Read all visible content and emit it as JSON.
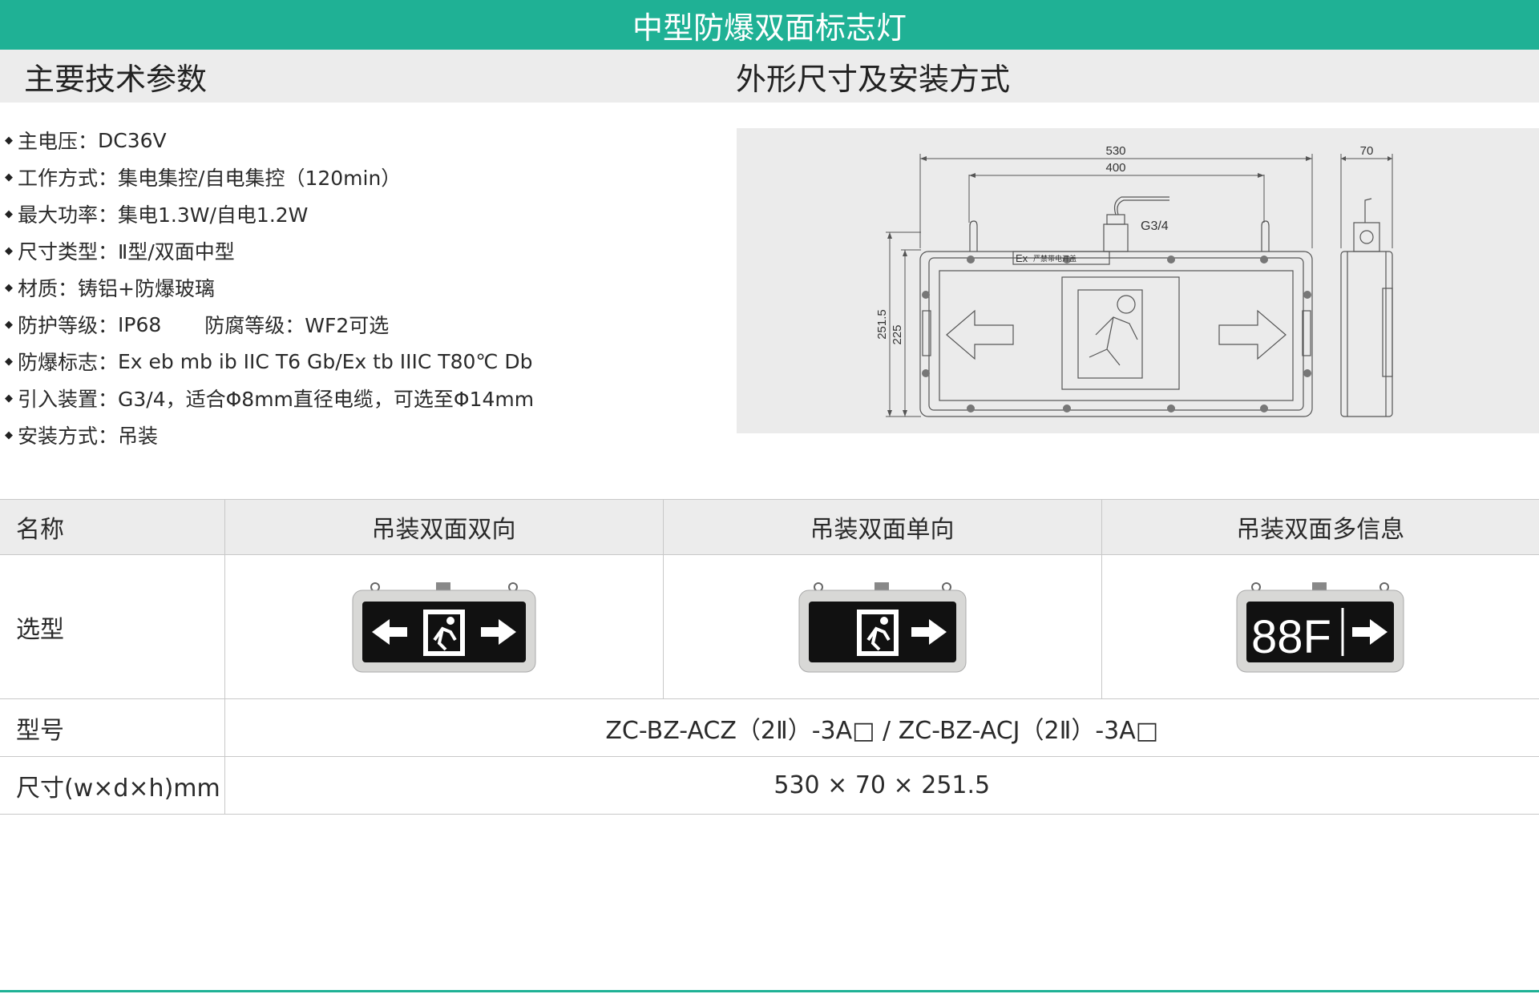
{
  "header": {
    "title": "中型防爆双面标志灯"
  },
  "sections": {
    "left_title": "主要技术参数",
    "right_title": "外形尺寸及安装方式"
  },
  "specs": [
    {
      "label": "主电压：",
      "value": "DC36V"
    },
    {
      "label": "工作方式：",
      "value": "集电集控/自电集控（120min）"
    },
    {
      "label": "最大功率：",
      "value": "集电1.3W/自电1.2W"
    },
    {
      "label": "尺寸类型：",
      "value": "Ⅱ型/双面中型"
    },
    {
      "label": "材质：",
      "value": "铸铝+防爆玻璃"
    },
    {
      "label": "防护等级：",
      "value": "IP68",
      "label2": "防腐等级：",
      "value2": "WF2可选"
    },
    {
      "label": "防爆标志：",
      "value": "Ex eb mb ib IIC T6 Gb/Ex tb IIIC T80℃ Db"
    },
    {
      "label": "引入装置：",
      "value": "G3/4，适合Φ8mm直径电缆，可选至Φ14mm"
    },
    {
      "label": "安装方式：",
      "value": "吊装"
    }
  ],
  "drawing": {
    "dim_width_total": "530",
    "dim_width_mount": "400",
    "dim_depth": "70",
    "dim_height_total": "251.5",
    "dim_height_body": "225",
    "thread_label": "G3/4",
    "ex_mark": "Ex",
    "warning_label": "严禁带电开盖"
  },
  "table": {
    "head": {
      "name": "名称",
      "cols": [
        "吊装双面双向",
        "吊装双面单向",
        "吊装双面多信息"
      ]
    },
    "row_image": {
      "label": "选型",
      "sign_text": "88F"
    },
    "row_model": {
      "label": "型号",
      "value": "ZC-BZ-ACZ（2Ⅱ）-3A□ / ZC-BZ-ACJ（2Ⅱ）-3A□"
    },
    "row_size": {
      "label": "尺寸(w×d×h)mm",
      "value": "530 × 70 × 251.5"
    }
  },
  "colors": {
    "accent": "#1fb195",
    "band": "#ececec",
    "drawing_bg": "#ebebeb"
  }
}
